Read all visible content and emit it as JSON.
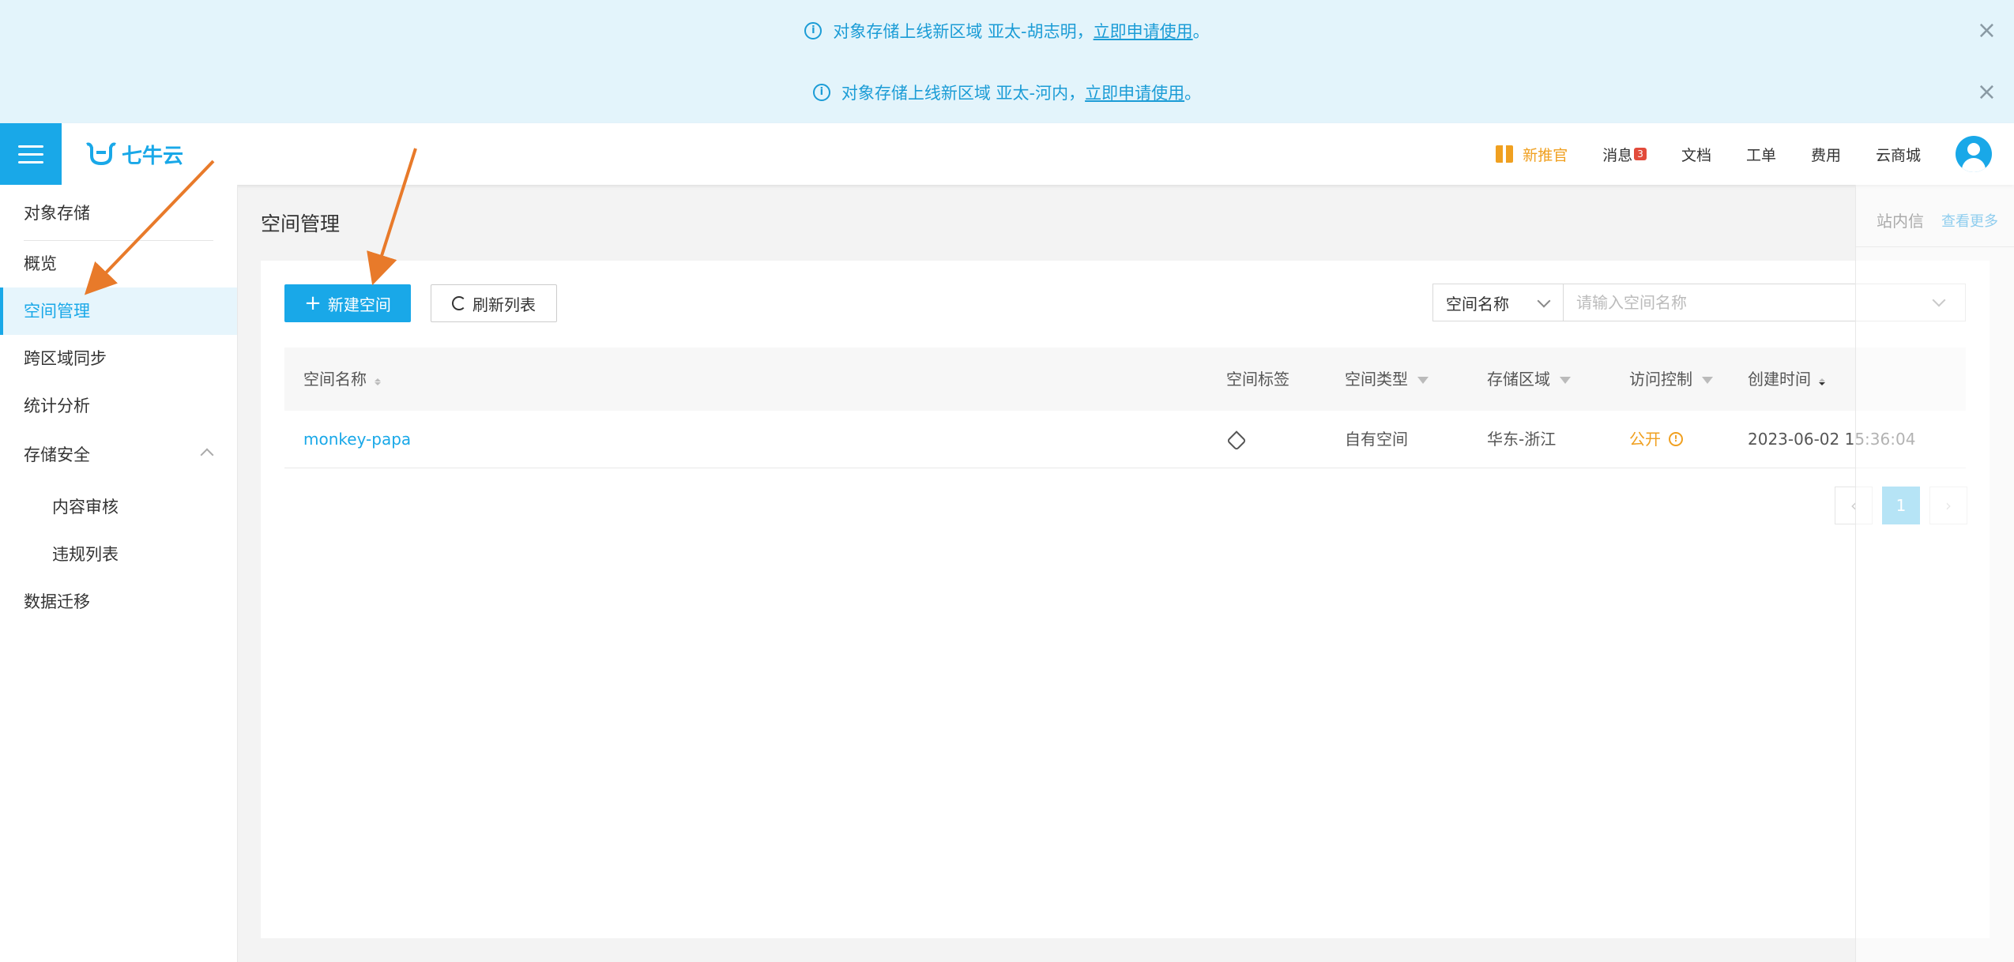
{
  "banners": [
    {
      "text": "对象存储上线新区域 亚太-胡志明，",
      "link": "立即申请使用",
      "suffix": "。"
    },
    {
      "text": "对象存储上线新区域 亚太-河内，",
      "link": "立即申请使用",
      "suffix": "。"
    }
  ],
  "header": {
    "logo_text": "七牛云",
    "promo": "新推官",
    "messages": "消息",
    "message_count": "3",
    "docs": "文档",
    "tickets": "工单",
    "billing": "费用",
    "market": "云商城"
  },
  "sidebar": {
    "section": "对象存储",
    "items": [
      {
        "label": "概览"
      },
      {
        "label": "空间管理",
        "active": true
      },
      {
        "label": "跨区域同步"
      },
      {
        "label": "统计分析"
      },
      {
        "label": "存储安全"
      },
      {
        "label": "内容审核"
      },
      {
        "label": "违规列表"
      },
      {
        "label": "数据迁移"
      }
    ]
  },
  "main": {
    "title": "空间管理",
    "new_bucket": "新建空间",
    "refresh": "刷新列表",
    "search_field": "空间名称",
    "search_placeholder": "请输入空间名称",
    "columns": [
      "空间名称",
      "空间标签",
      "空间类型",
      "存储区域",
      "访问控制",
      "创建时间"
    ],
    "rows": [
      {
        "name": "monkey-papa",
        "type": "自有空间",
        "region": "华东-浙江",
        "access": "公开",
        "created": "2023-06-02 15:36:04"
      }
    ],
    "pagination": {
      "current": "1"
    }
  },
  "notice": {
    "title": "站内信",
    "more": "查看更多"
  },
  "colors": {
    "accent": "#19a8e8",
    "warning": "#f0a020",
    "banner_bg": "#e3f4fb",
    "arrow": "#e87a2a"
  }
}
